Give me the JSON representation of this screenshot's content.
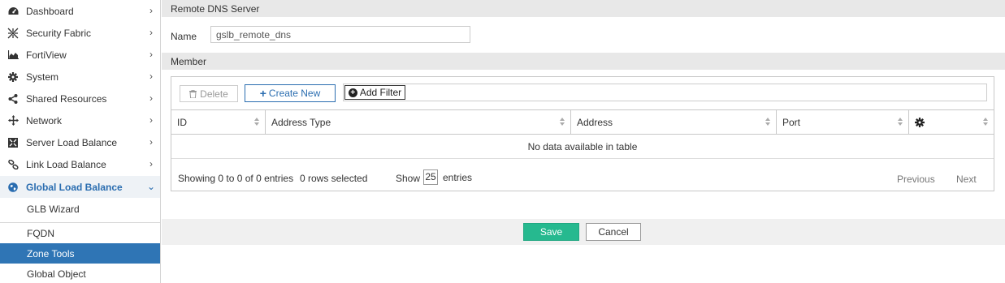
{
  "sidebar": {
    "items": [
      {
        "label": "Dashboard",
        "icon": "dashboard-icon"
      },
      {
        "label": "Security Fabric",
        "icon": "security-fabric-icon"
      },
      {
        "label": "FortiView",
        "icon": "area-chart-icon"
      },
      {
        "label": "System",
        "icon": "gear-icon"
      },
      {
        "label": "Shared Resources",
        "icon": "share-icon"
      },
      {
        "label": "Network",
        "icon": "move-arrows-icon"
      },
      {
        "label": "Server Load Balance",
        "icon": "server-load-balance-icon"
      },
      {
        "label": "Link Load Balance",
        "icon": "link-icon"
      },
      {
        "label": "Global Load Balance",
        "icon": "globe-icon"
      }
    ],
    "sub_items": [
      {
        "label": "GLB Wizard"
      },
      {
        "label": "FQDN"
      },
      {
        "label": "Zone Tools"
      },
      {
        "label": "Global Object"
      }
    ]
  },
  "main": {
    "section_title": "Remote DNS Server",
    "name_label": "Name",
    "name_value": "gslb_remote_dns",
    "member_title": "Member",
    "toolbar": {
      "delete_label": "Delete",
      "create_label": "Create New",
      "filter_label": "Add Filter"
    },
    "table": {
      "columns": [
        "ID",
        "Address Type",
        "Address",
        "Port"
      ],
      "empty_text": "No data available in table",
      "showing_text": "Showing 0 to 0 of 0 entries",
      "selected_text": "0 rows selected",
      "show_label": "Show",
      "page_size": "25",
      "entries_label": "entries",
      "previous_label": "Previous",
      "next_label": "Next"
    },
    "actions": {
      "save_label": "Save",
      "cancel_label": "Cancel"
    }
  },
  "colors": {
    "accent": "#2a6db0",
    "active_bg": "#2f75b5",
    "save_bg": "#26b98f"
  }
}
